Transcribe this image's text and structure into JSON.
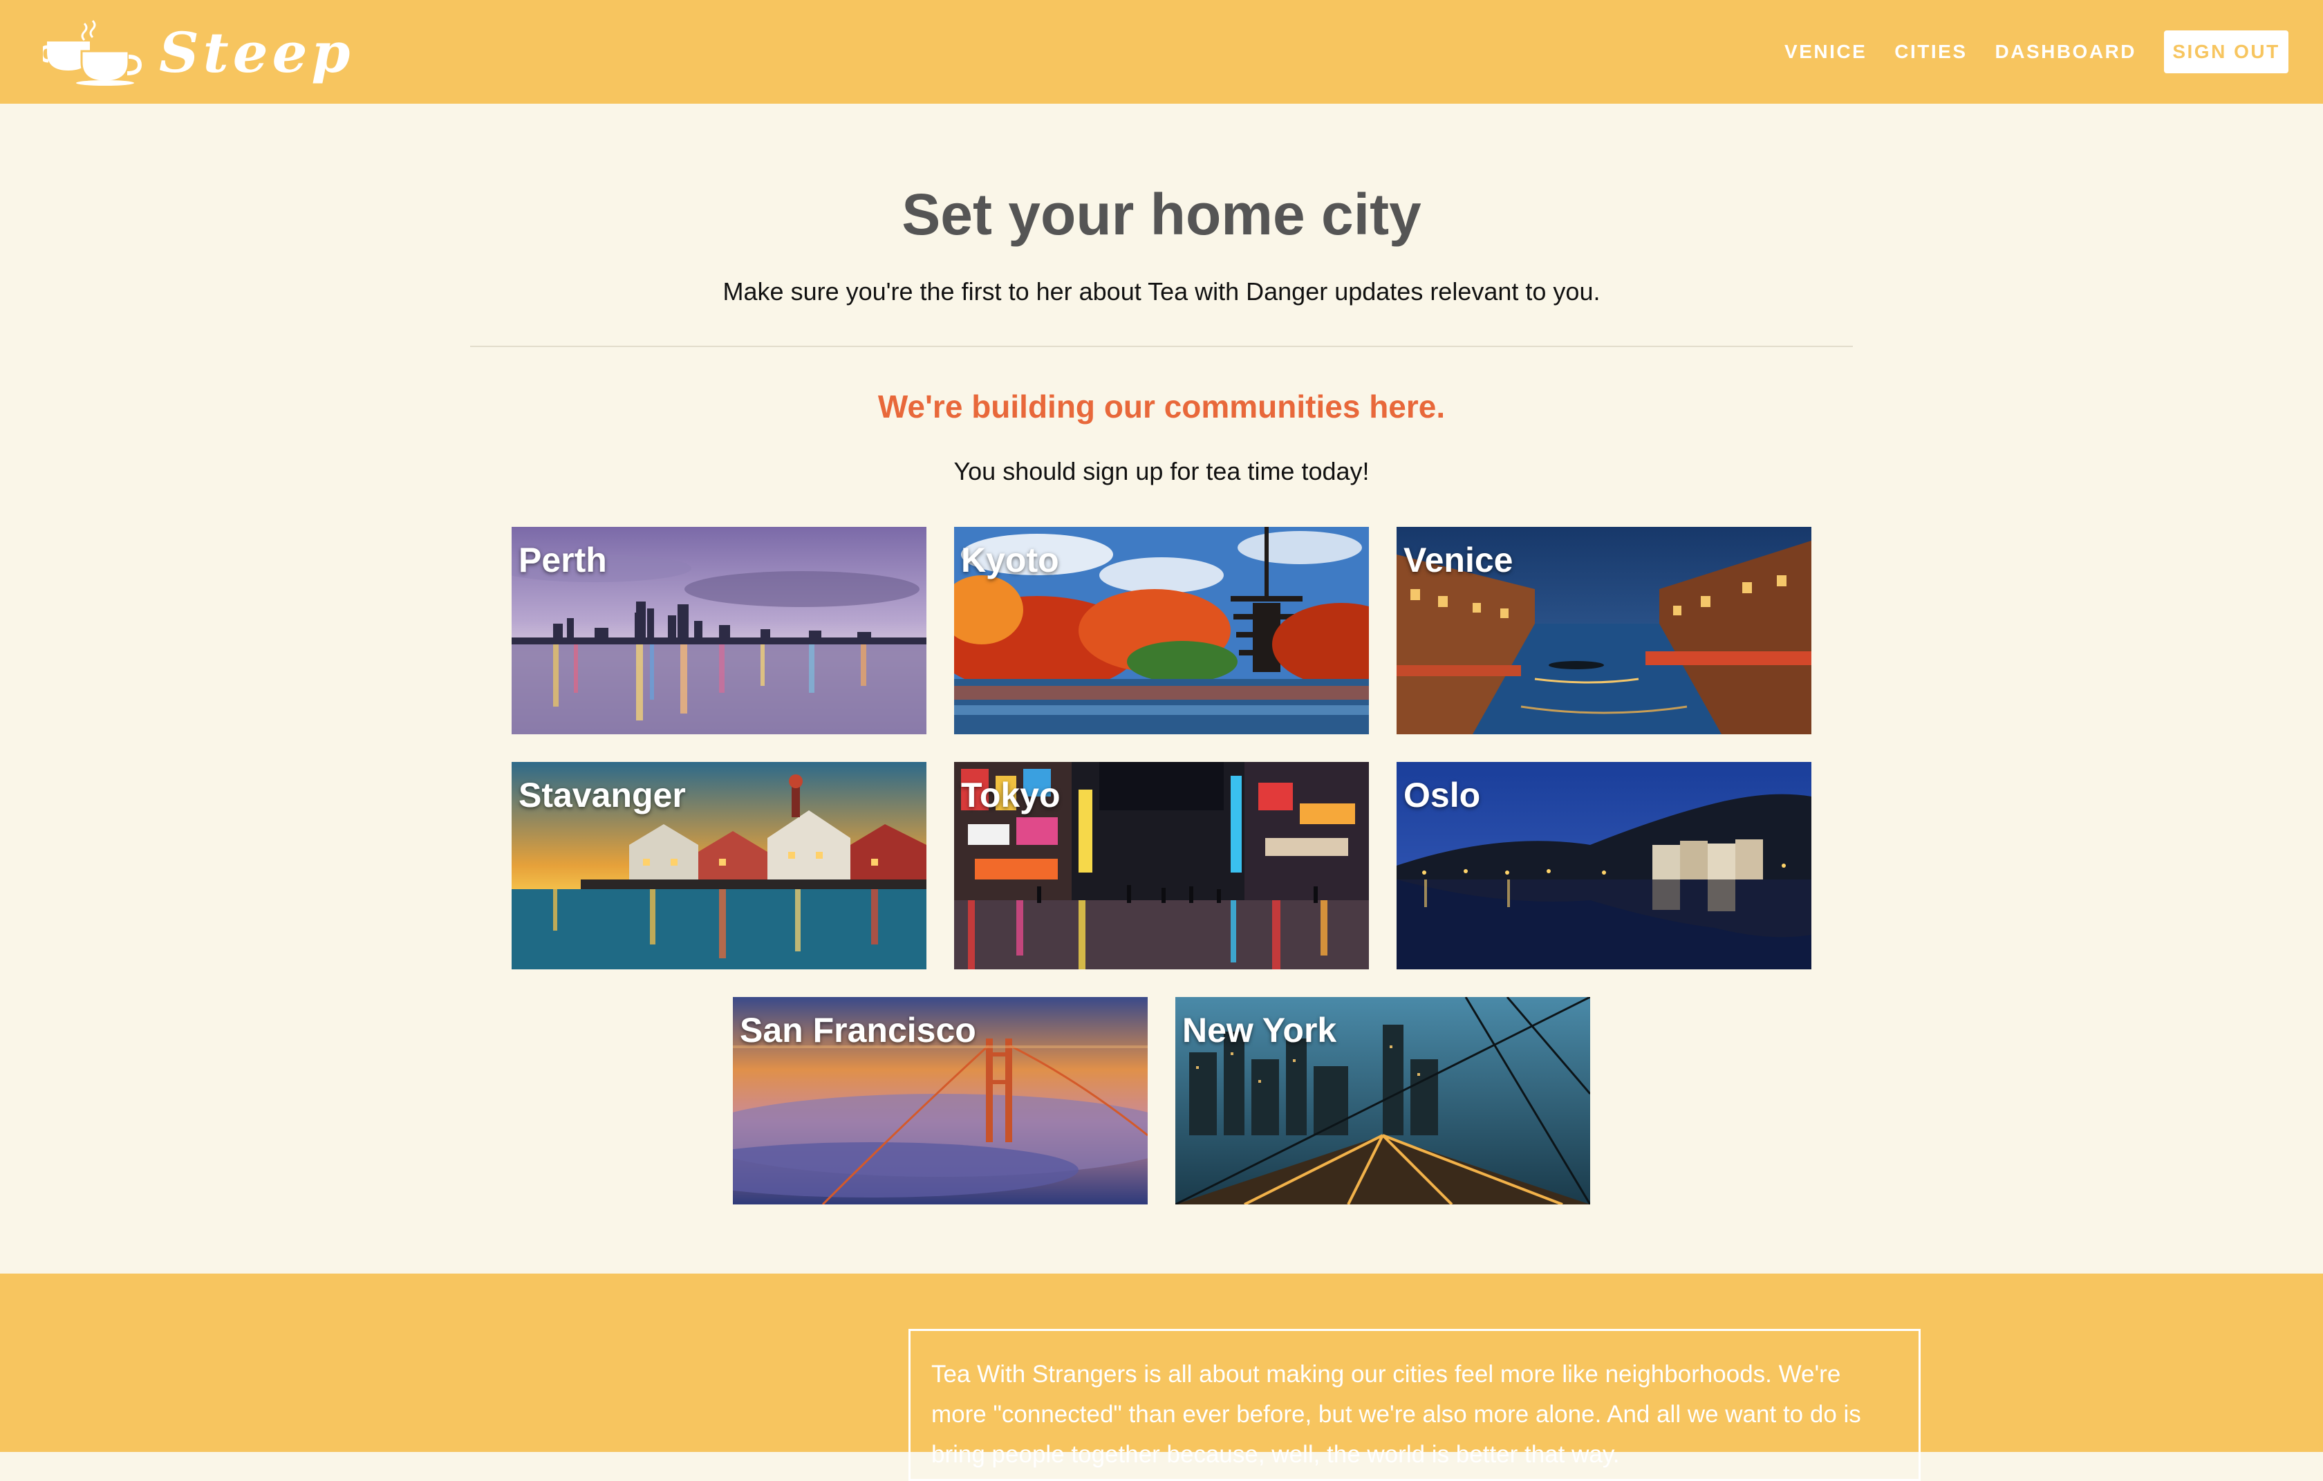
{
  "header": {
    "brand": "Steep",
    "nav": {
      "city": "VENICE",
      "cities": "CITIES",
      "dashboard": "DASHBOARD",
      "sign_out": "SIGN OUT"
    }
  },
  "main": {
    "title": "Set your home city",
    "subtitle": "Make sure you're the first to her about Tea with Danger updates relevant to you.",
    "communities_heading": "We're building our communities here.",
    "communities_sub": "You should sign up for tea time today!",
    "cities": [
      {
        "name": "Perth"
      },
      {
        "name": "Kyoto"
      },
      {
        "name": "Venice"
      },
      {
        "name": "Stavanger"
      },
      {
        "name": "Tokyo"
      },
      {
        "name": "Oslo"
      },
      {
        "name": "San Francisco"
      },
      {
        "name": "New York"
      }
    ]
  },
  "footer": {
    "about": "Tea With Strangers is all about making our cities feel more like neighborhoods. We're more \"connected\" than ever before, but we're also more alone. And all we want to do is bring people together because, well, the world is better that way."
  },
  "colors": {
    "header_bg": "#f7c55f",
    "page_bg": "#faf6e8",
    "accent": "#e8683a",
    "title": "#555555"
  },
  "icons": {
    "logo": "teacups-icon"
  }
}
